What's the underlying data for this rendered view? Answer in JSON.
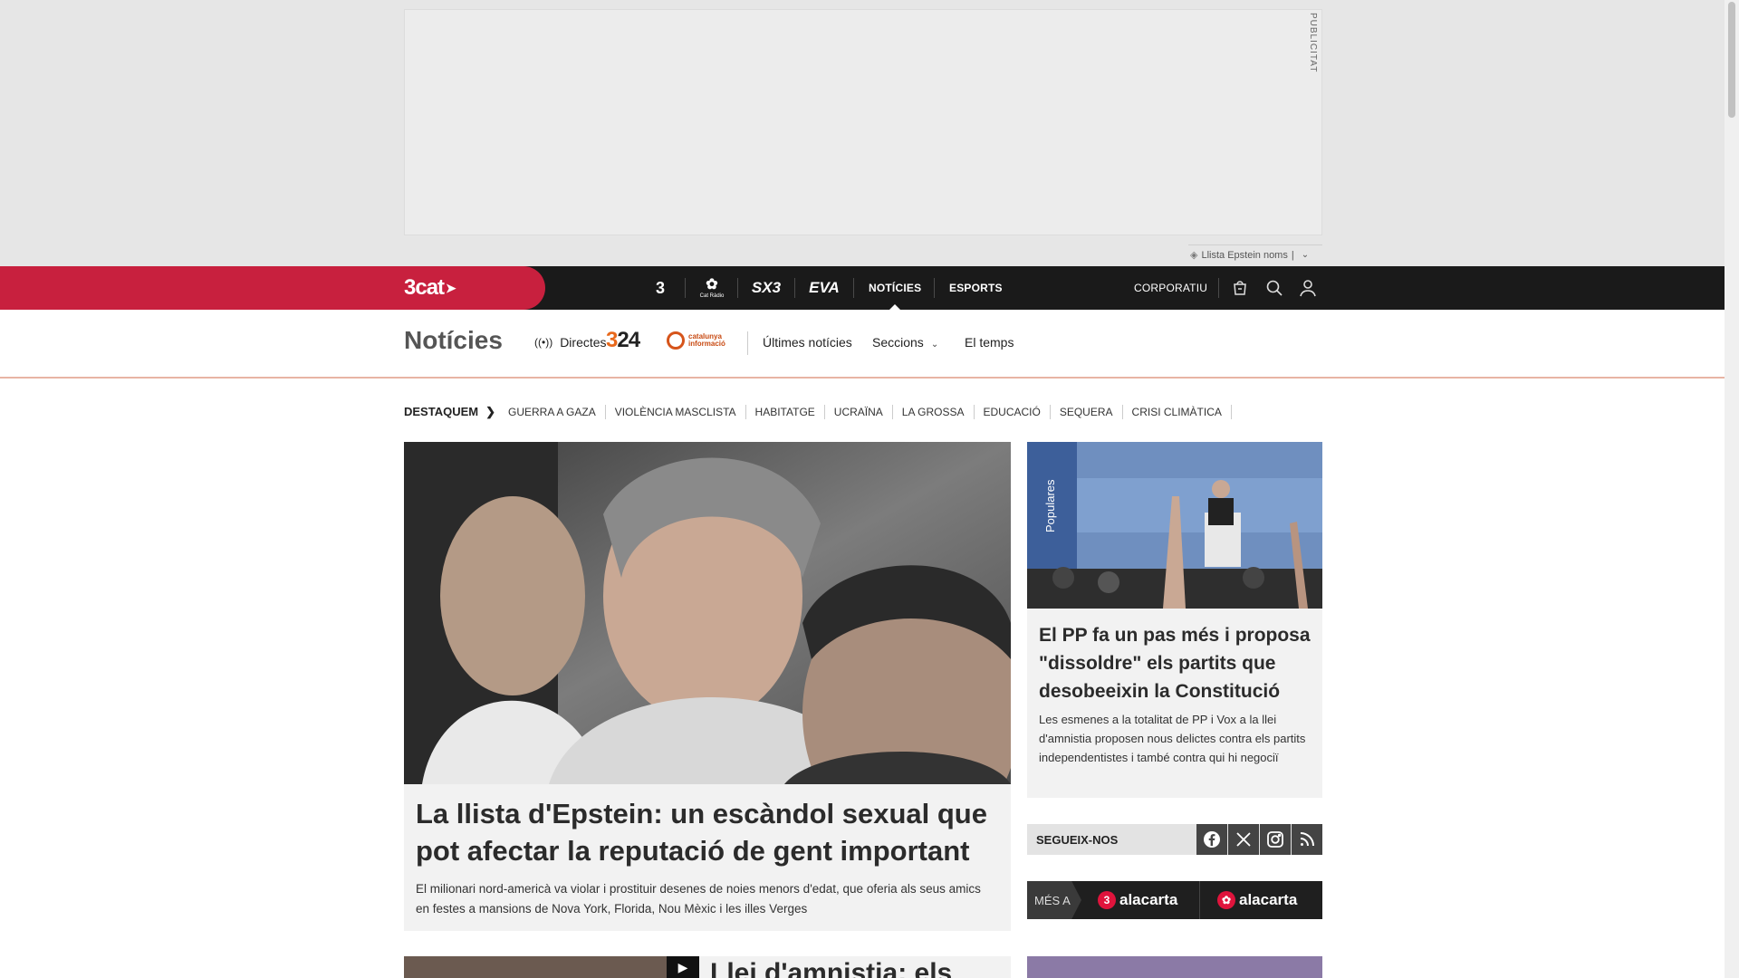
{
  "ad": {
    "label": "PUBLICITAT",
    "topic_tag": "Llista Epstein noms"
  },
  "topbar": {
    "brand": "3cat",
    "channels": [
      "3",
      "Cat Ràdio",
      "SX3",
      "EVA"
    ],
    "nav": {
      "noticies": "NOTÍCIES",
      "esports": "ESPORTS",
      "corporatiu": "CORPORATIU"
    },
    "icons": [
      "shop-icon",
      "search-icon",
      "user-icon"
    ]
  },
  "section": {
    "title": "Notícies",
    "directes": "Directes",
    "logo_324": "324",
    "logo_catinfo": "catalunya informació",
    "links": {
      "ultimes": "Últimes notícies",
      "seccions": "Seccions",
      "temps": "El temps"
    }
  },
  "destaquem": {
    "label": "DESTAQUEM",
    "tags": [
      "GUERRA A GAZA",
      "VIOLÈNCIA MASCLISTA",
      "HABITATGE",
      "UCRAÏNA",
      "LA GROSSA",
      "EDUCACIÓ",
      "SEQUERA",
      "CRISI CLIMÀTICA"
    ]
  },
  "feature": {
    "title": "La llista d'Epstein: un escàndol sexual que pot afectar la reputació de gent important",
    "summary": "El milionari nord-americà va violar i prostituir desenes de noies menors d'edat, que oferia als seus amics en festes a mansions de Nova York, Florida, Nou Mèxic i les illes Verges"
  },
  "side": {
    "title": "El PP fa un pas més i proposa \"dissoldre\" els partits que desobeeixin la Constitució",
    "summary": "Les esmenes a la totalitat de PP i Vox a la llei d'amnistia proposen nous delictes contra els partits independentistes i també contra qui hi negociï",
    "image_text": "Populares"
  },
  "follow": {
    "label": "SEGUEIX-NOS"
  },
  "alacarta": {
    "mes_a": "MÉS A",
    "tv_badge": "3",
    "tv_label": "alacarta",
    "radio_label": "alacarta"
  },
  "peek": {
    "title": "Llei d'amnistia: els"
  }
}
